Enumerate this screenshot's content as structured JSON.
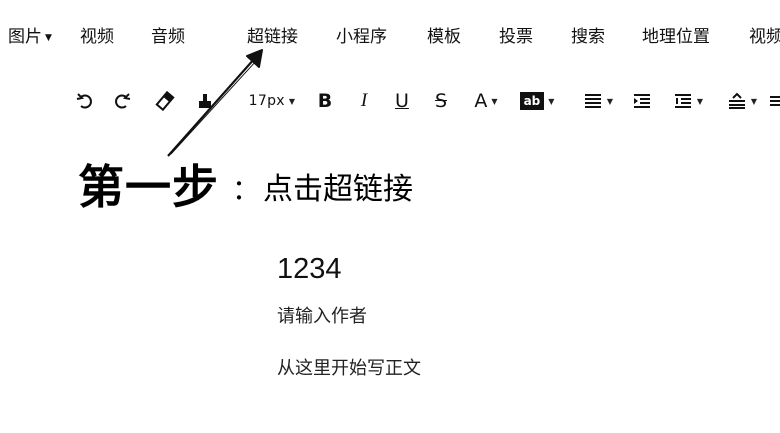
{
  "menubar": {
    "items": [
      {
        "label": "图片",
        "has_caret": true
      },
      {
        "label": "视频"
      },
      {
        "label": "音频"
      },
      {
        "label": "超链接"
      },
      {
        "label": "小程序"
      },
      {
        "label": "模板"
      },
      {
        "label": "投票"
      },
      {
        "label": "搜索"
      },
      {
        "label": "地理位置"
      },
      {
        "label": "视频"
      }
    ]
  },
  "toolbar": {
    "font_size": "17px",
    "bold": "B",
    "italic": "I",
    "underline": "U",
    "strike": "S",
    "font_color": "A",
    "bg_color": "ab"
  },
  "annotation": {
    "step": "第一步",
    "colon": "：",
    "instruction": "点击超链接"
  },
  "editor": {
    "title": "1234",
    "author_placeholder": "请输入作者",
    "body_placeholder": "从这里开始写正文"
  }
}
